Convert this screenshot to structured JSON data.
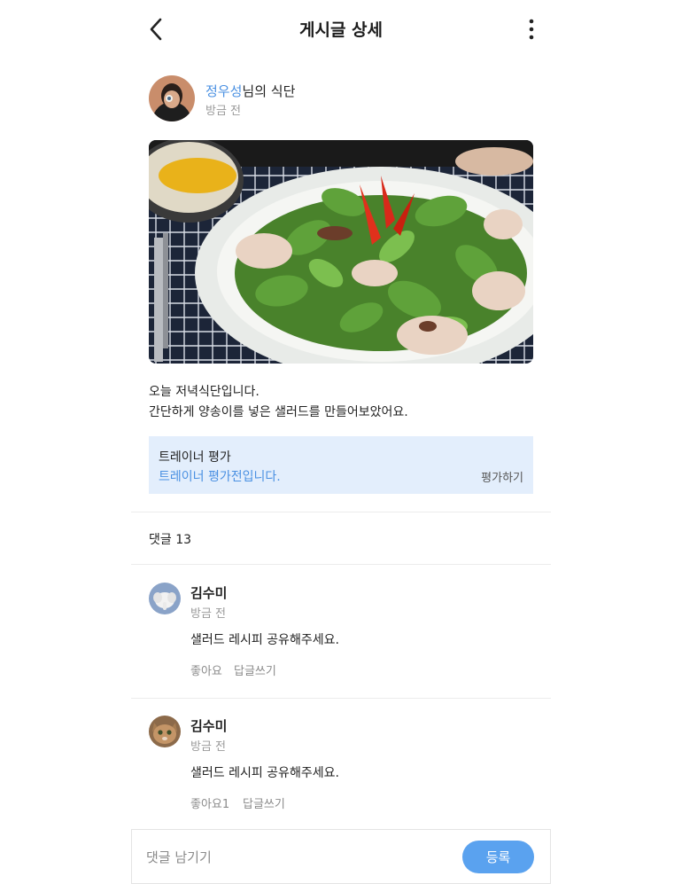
{
  "header": {
    "title": "게시글 상세",
    "back_icon": "chevron-left-icon",
    "more_icon": "vertical-ellipsis-icon"
  },
  "post": {
    "author_name": "정우성",
    "author_suffix": "님의 식단",
    "time": "방금 전",
    "photo": "salad-photo",
    "body": "오늘 저녁식단입니다.\n간단하게 양송이를 넣은 샐러드를 만들어보았어요."
  },
  "trainer": {
    "title": "트레이너 평가",
    "status": "트레이너 평가전입니다.",
    "action": "평가하기"
  },
  "comments_header": "댓글 13",
  "comments": [
    {
      "name": "김수미",
      "time": "방금 전",
      "text": "샐러드 레시피 공유해주세요.",
      "like": "좋아요",
      "reply": "답글쓰기"
    },
    {
      "name": "김수미",
      "time": "방금 전",
      "text": "샐러드 레시피 공유해주세요.",
      "like": "좋아요1",
      "reply": "답글쓰기"
    }
  ],
  "input": {
    "placeholder": "댓글 남기기",
    "submit": "등록"
  },
  "colors": {
    "accent": "#4a90e2",
    "trainer_bg": "#e3eefc",
    "button": "#5aa2ef"
  }
}
